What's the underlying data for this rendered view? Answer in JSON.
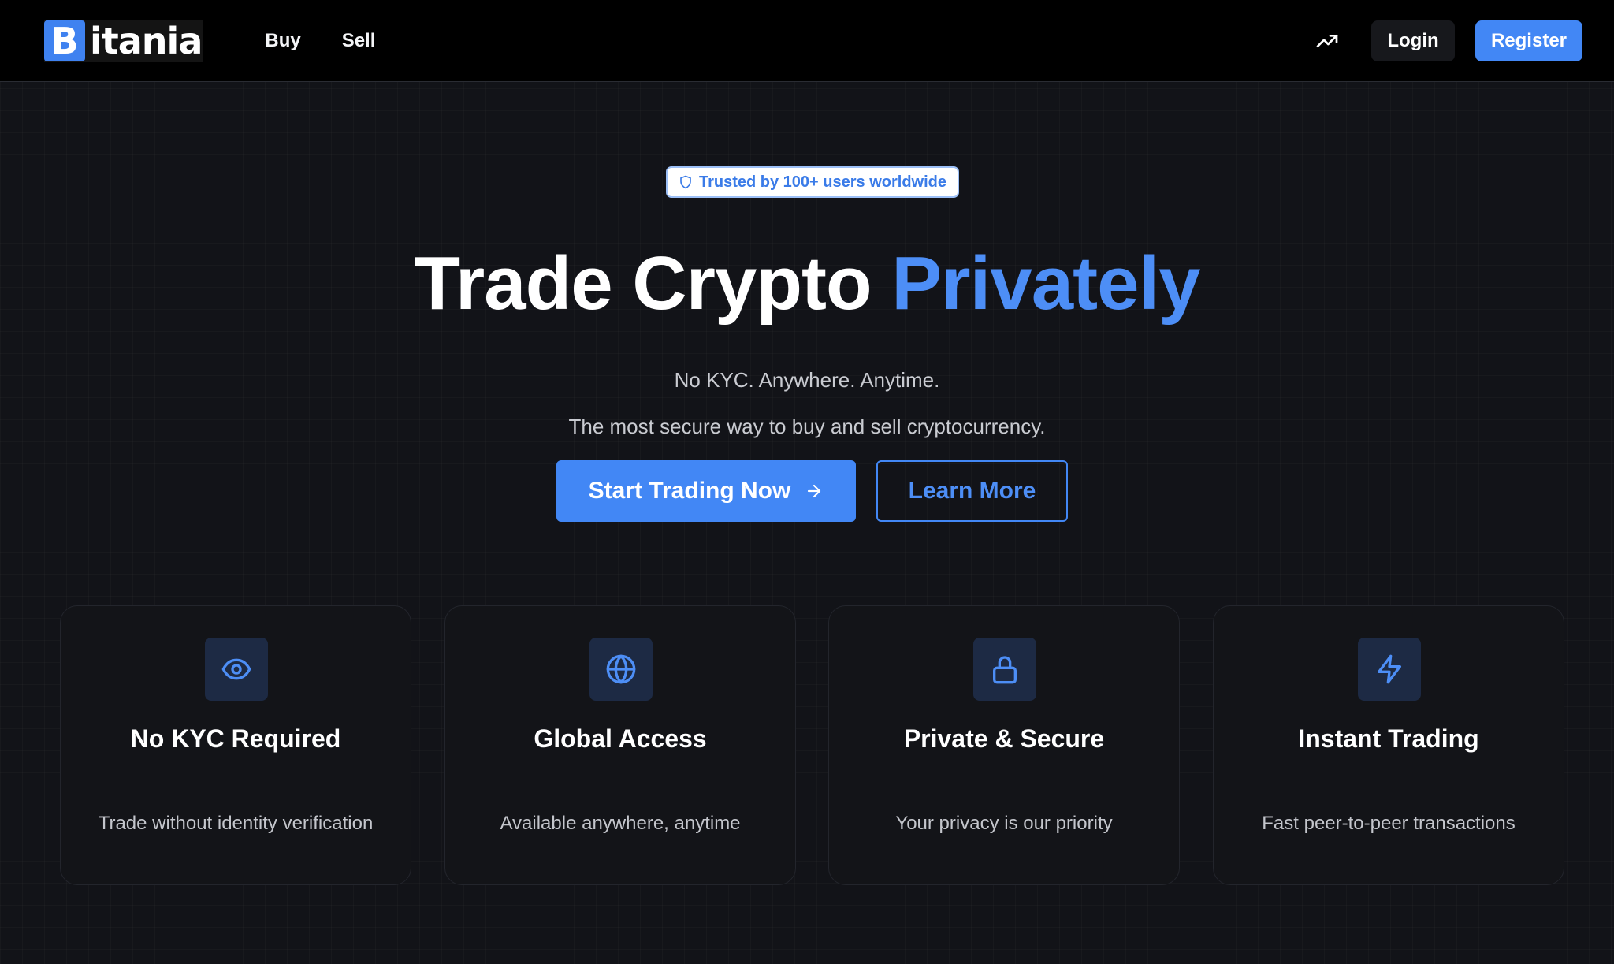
{
  "brand": {
    "logo_mark": "B",
    "logo_text": "itania"
  },
  "nav": {
    "links": [
      "Buy",
      "Sell"
    ],
    "trend_icon": "trending-up-icon",
    "login_label": "Login",
    "register_label": "Register"
  },
  "hero": {
    "badge_icon": "shield-icon",
    "badge_text": "Trusted by 100+ users worldwide",
    "title_main": "Trade Crypto",
    "title_accent": "Privately",
    "tagline": "No KYC. Anywhere. Anytime.",
    "subtitle": "The most secure way to buy and sell cryptocurrency.",
    "primary_cta": "Start Trading Now",
    "secondary_cta": "Learn More"
  },
  "features": [
    {
      "icon": "eye-icon",
      "title": "No KYC Required",
      "description": "Trade without identity verification"
    },
    {
      "icon": "globe-icon",
      "title": "Global Access",
      "description": "Available anywhere, anytime"
    },
    {
      "icon": "lock-icon",
      "title": "Private & Secure",
      "description": "Your privacy is our priority"
    },
    {
      "icon": "lightning-icon",
      "title": "Instant Trading",
      "description": "Fast peer-to-peer transactions"
    }
  ],
  "colors": {
    "accent": "#4287f5",
    "background": "#121318",
    "navbar": "#000000",
    "card": "#131418",
    "icon_box": "#1d2a44"
  }
}
